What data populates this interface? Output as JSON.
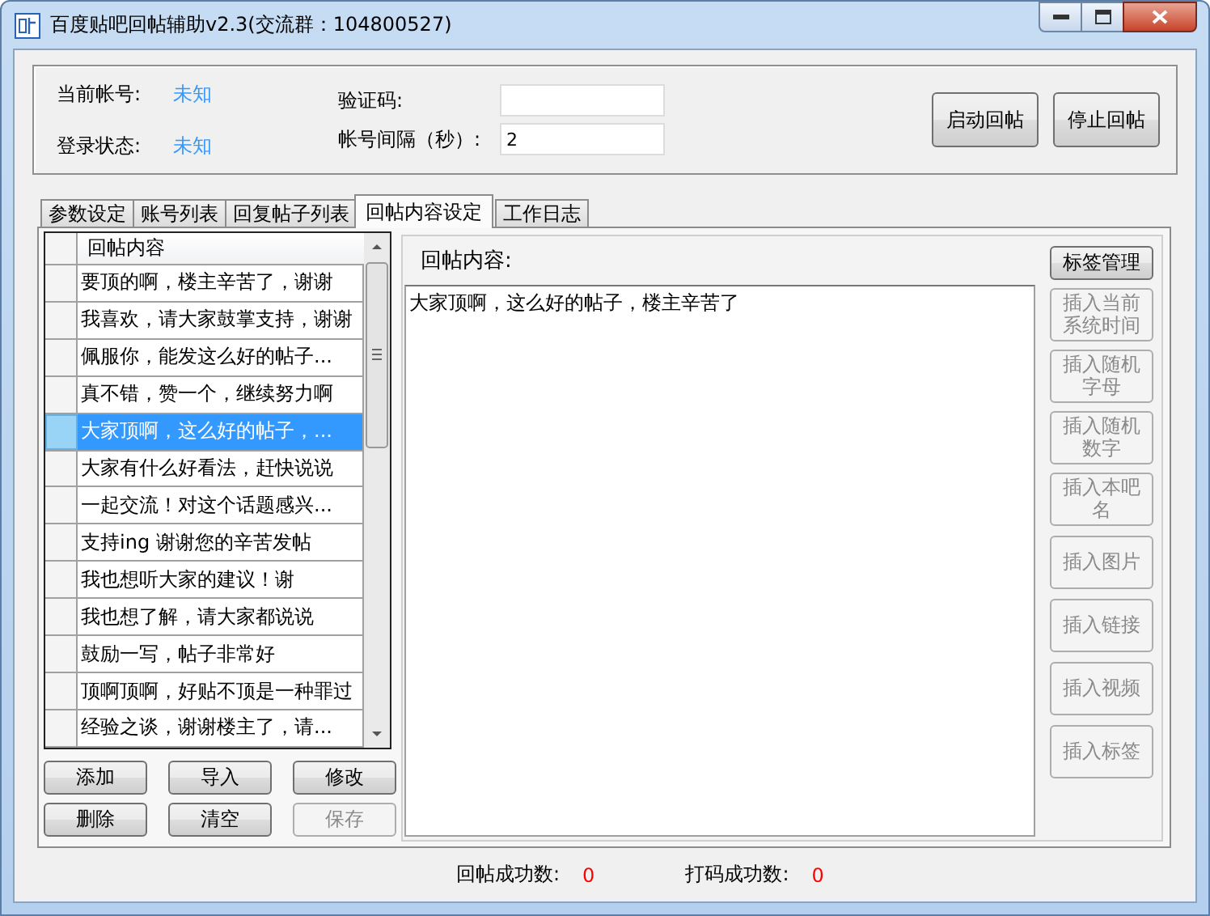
{
  "window": {
    "title": "百度贴吧回帖辅助v2.3(交流群：104800527)"
  },
  "status_panel": {
    "items": [
      {
        "label": "当前帐号:",
        "value": "未知"
      },
      {
        "label": "登录状态:",
        "value": "未知"
      }
    ],
    "fields": [
      {
        "label": "验证码:"
      },
      {
        "label": "帐号间隔（秒）:",
        "value": "2"
      }
    ],
    "buttons": [
      {
        "label": "启动回帖"
      },
      {
        "label": "停止回帖"
      }
    ]
  },
  "tabs": [
    {
      "label": "参数设定",
      "selected": false
    },
    {
      "label": "账号列表",
      "selected": false
    },
    {
      "label": "回复帖子列表",
      "selected": false
    },
    {
      "label": "回帖内容设定",
      "selected": true
    },
    {
      "label": "工作日志",
      "selected": false
    }
  ],
  "reply_table": {
    "columns": [
      "回帖内容"
    ],
    "rows": [
      {
        "text": "要顶的啊，楼主辛苦了，谢谢",
        "selected": false
      },
      {
        "text": "我喜欢，请大家鼓掌支持，谢谢",
        "selected": false
      },
      {
        "text": "佩服你，能发这么好的帖子...",
        "selected": false
      },
      {
        "text": "真不错，赞一个，继续努力啊",
        "selected": false
      },
      {
        "text": "大家顶啊，这么好的帖子，...",
        "selected": true
      },
      {
        "text": "大家有什么好看法，赶快说说",
        "selected": false
      },
      {
        "text": "一起交流！对这个话题感兴...",
        "selected": false
      },
      {
        "text": "支持ing 谢谢您的辛苦发帖",
        "selected": false
      },
      {
        "text": "我也想听大家的建议！谢",
        "selected": false
      },
      {
        "text": "我也想了解，请大家都说说",
        "selected": false
      },
      {
        "text": "鼓励一写，帖子非常好",
        "selected": false
      },
      {
        "text": "顶啊顶啊，好贴不顶是一种罪过",
        "selected": false
      },
      {
        "text": "经验之谈，谢谢楼主了，请...",
        "selected": false
      }
    ]
  },
  "list_buttons": [
    {
      "label": "添加",
      "disabled": false
    },
    {
      "label": "导入",
      "disabled": false
    },
    {
      "label": "修改",
      "disabled": false
    },
    {
      "label": "删除",
      "disabled": false
    },
    {
      "label": "清空",
      "disabled": false
    },
    {
      "label": "保存",
      "disabled": true
    }
  ],
  "editor": {
    "label": "回帖内容:",
    "value": "大家顶啊，这么好的帖子，楼主辛苦了"
  },
  "side_buttons": [
    {
      "label": "标签管理",
      "disabled": false
    },
    {
      "label": "插入当前系统时间",
      "disabled": true
    },
    {
      "label": "插入随机字母",
      "disabled": true
    },
    {
      "label": "插入随机数字",
      "disabled": true
    },
    {
      "label": "插入本吧名",
      "disabled": true
    },
    {
      "label": "插入图片",
      "disabled": true
    },
    {
      "label": "插入链接",
      "disabled": true
    },
    {
      "label": "插入视频",
      "disabled": true
    },
    {
      "label": "插入标签",
      "disabled": true
    }
  ],
  "status_bar": [
    {
      "label": "回帖成功数:",
      "value": "0"
    },
    {
      "label": "打码成功数:",
      "value": "0"
    }
  ]
}
